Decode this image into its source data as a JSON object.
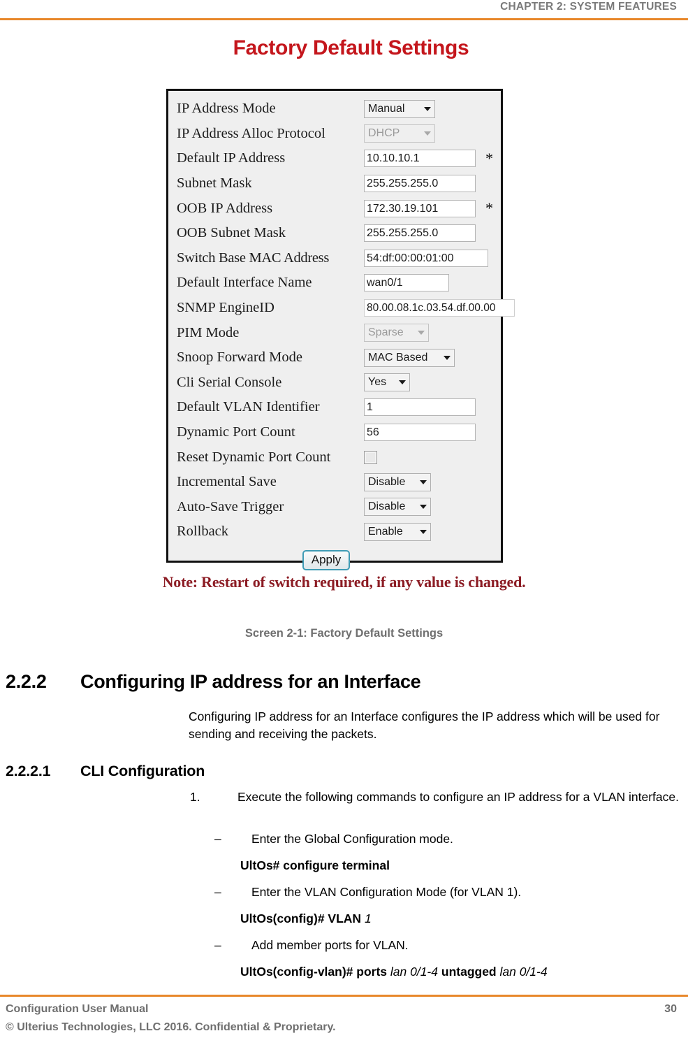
{
  "header": {
    "chapter": "CHAPTER 2: SYSTEM FEATURES",
    "rule_color": "#E8882B"
  },
  "figure": {
    "title": "Factory Default Settings",
    "title_color": "#C4161C",
    "note": "Note: Restart of switch required, if any value is changed.",
    "note_color": "#8C1C24",
    "caption": "Screen 2-1: Factory Default Settings",
    "apply_label": "Apply",
    "form_rows": [
      {
        "label": "IP Address Mode",
        "control": "select",
        "value": "Manual",
        "disabled": false,
        "required": false
      },
      {
        "label": "IP Address Alloc Protocol",
        "control": "select",
        "value": "DHCP",
        "disabled": true,
        "required": false
      },
      {
        "label": "Default IP Address",
        "control": "text",
        "value": "10.10.10.1",
        "disabled": false,
        "required": true
      },
      {
        "label": "Subnet Mask",
        "control": "text",
        "value": "255.255.255.0",
        "disabled": false,
        "required": false
      },
      {
        "label": "OOB IP Address",
        "control": "text",
        "value": "172.30.19.101",
        "disabled": false,
        "required": true
      },
      {
        "label": "OOB Subnet Mask",
        "control": "text",
        "value": "255.255.255.0",
        "disabled": false,
        "required": false
      },
      {
        "label": "Switch Base MAC Address",
        "control": "text",
        "value": "54:df:00:00:01:00",
        "disabled": false,
        "required": false
      },
      {
        "label": "Default Interface Name",
        "control": "text",
        "value": "wan0/1",
        "disabled": false,
        "required": false
      },
      {
        "label": "SNMP EngineID",
        "control": "text",
        "value": "80.00.08.1c.03.54.df.00.00",
        "disabled": false,
        "required": false
      },
      {
        "label": "PIM Mode",
        "control": "select",
        "value": "Sparse",
        "disabled": true,
        "required": false
      },
      {
        "label": "Snoop Forward Mode",
        "control": "select",
        "value": "MAC Based",
        "disabled": false,
        "required": false
      },
      {
        "label": "Cli Serial Console",
        "control": "select",
        "value": "Yes",
        "disabled": false,
        "required": false
      },
      {
        "label": "Default VLAN Identifier",
        "control": "text",
        "value": "1",
        "disabled": false,
        "required": false
      },
      {
        "label": "Dynamic Port Count",
        "control": "text",
        "value": "56",
        "disabled": false,
        "required": false
      },
      {
        "label": "Reset Dynamic Port Count",
        "control": "checkbox",
        "value": "",
        "disabled": false,
        "required": false,
        "checked": false
      },
      {
        "label": "Incremental Save",
        "control": "select",
        "value": "Disable",
        "disabled": false,
        "required": false
      },
      {
        "label": "Auto-Save Trigger",
        "control": "select",
        "value": "Disable",
        "disabled": false,
        "required": false
      },
      {
        "label": "Rollback",
        "control": "select",
        "value": "Enable",
        "disabled": false,
        "required": false
      }
    ],
    "required_marker": "*"
  },
  "sections": {
    "h2_number": "2.2.2",
    "h2_title": "Configuring IP address for an Interface",
    "h2_body": "Configuring IP address for an Interface configures the IP address which will be used for sending and receiving the packets.",
    "h3_number": "2.2.2.1",
    "h3_title": "CLI Configuration",
    "step1_number": "1.",
    "step1_text": "Execute the following commands to configure an IP address for a VLAN interface.",
    "dash": "–",
    "bullet1_text": "Enter the Global Configuration mode.",
    "cmd1_prompt": "UltOs# configure terminal",
    "bullet2_text": "Enter the VLAN Configuration Mode (for VLAN 1).",
    "cmd2_prompt": "UltOs(config)# VLAN",
    "cmd2_arg": "1",
    "bullet3_text": "Add member ports for VLAN.",
    "cmd3_prompt": "UltOs(config-vlan)# ports",
    "cmd3_arg1": "lan 0/1-4",
    "cmd3_kw": "untagged",
    "cmd3_arg2": "lan 0/1-4"
  },
  "footer": {
    "manual_title": "Configuration User Manual",
    "copyright": "© Ulterius Technologies, LLC 2016. Confidential & Proprietary.",
    "page_number": "30"
  }
}
